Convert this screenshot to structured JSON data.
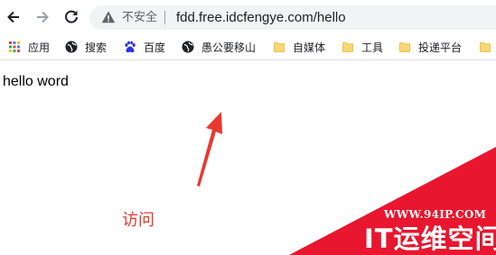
{
  "browser": {
    "security_label": "不安全",
    "url": "fdd.free.idcfengye.com/hello"
  },
  "bookmarks": [
    {
      "label": "应用",
      "icon": "apps-grid-icon"
    },
    {
      "label": "搜索",
      "icon": "globe-icon"
    },
    {
      "label": "百度",
      "icon": "baidu-paw-icon"
    },
    {
      "label": "愚公要移山",
      "icon": "globe-icon"
    },
    {
      "label": "自媒体",
      "icon": "folder-icon"
    },
    {
      "label": "工具",
      "icon": "folder-icon"
    },
    {
      "label": "投递平台",
      "icon": "folder-icon"
    },
    {
      "label": "",
      "icon": "folder-icon"
    }
  ],
  "page": {
    "body_text": "hello word"
  },
  "annotation": {
    "label": "访问",
    "color": "#e8382f"
  },
  "watermark": {
    "site": "WWW.94IP.COM",
    "brand": "IT运维空间",
    "color": "#e8162e"
  }
}
